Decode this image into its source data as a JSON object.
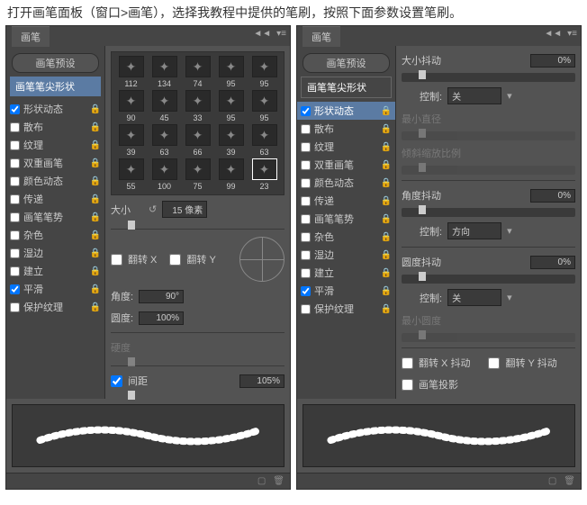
{
  "instruction": "打开画笔面板（窗口>画笔），选择我教程中提供的笔刷，按照下面参数设置笔刷。",
  "tab_title": "画笔",
  "preset_btn": "画笔预设",
  "tip_shape": "画笔笔尖形状",
  "sidebar_items": [
    {
      "checked": true,
      "label": "形状动态",
      "locked": true
    },
    {
      "checked": false,
      "label": "散布",
      "locked": true
    },
    {
      "checked": false,
      "label": "纹理",
      "locked": true
    },
    {
      "checked": false,
      "label": "双重画笔",
      "locked": true
    },
    {
      "checked": false,
      "label": "颜色动态",
      "locked": true
    },
    {
      "checked": false,
      "label": "传递",
      "locked": true
    },
    {
      "checked": false,
      "label": "画笔笔势",
      "locked": true
    },
    {
      "checked": false,
      "label": "杂色",
      "locked": true
    },
    {
      "checked": false,
      "label": "湿边",
      "locked": true
    },
    {
      "checked": false,
      "label": "建立",
      "locked": true
    },
    {
      "checked": true,
      "label": "平滑",
      "locked": true
    },
    {
      "checked": false,
      "label": "保护纹理",
      "locked": true
    }
  ],
  "left": {
    "brush_sizes": [
      "112",
      "134",
      "74",
      "95",
      "95",
      "90",
      "45",
      "33",
      "95",
      "95",
      "39",
      "63",
      "66",
      "39",
      "63",
      "55",
      "100",
      "75",
      "99",
      "23"
    ],
    "selected_brush_index": 19,
    "size_label": "大小",
    "size_value": "15 像素",
    "flip_x": "翻转 X",
    "flip_y": "翻转 Y",
    "angle_label": "角度:",
    "angle_value": "90°",
    "roundness_label": "圆度:",
    "roundness_value": "100%",
    "hardness_label": "硬度",
    "spacing_label": "间距",
    "spacing_value": "105%"
  },
  "right": {
    "size_jitter_label": "大小抖动",
    "size_jitter_value": "0%",
    "control_label": "控制:",
    "control_off": "关",
    "min_diameter": "最小直径",
    "tilt_scale": "倾斜缩放比例",
    "angle_jitter_label": "角度抖动",
    "angle_jitter_value": "0%",
    "control_direction": "方向",
    "roundness_jitter_label": "圆度抖动",
    "roundness_jitter_value": "0%",
    "min_roundness": "最小圆度",
    "flip_x_jitter": "翻转 X 抖动",
    "flip_y_jitter": "翻转 Y 抖动",
    "brush_projection": "画笔投影"
  }
}
